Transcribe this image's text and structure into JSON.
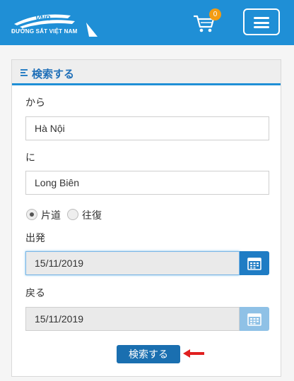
{
  "header": {
    "logo_text": "ĐƯỜNG SẮT VIỆT NAM",
    "cart_count": "0"
  },
  "form": {
    "title": "検索する",
    "from_label": "から",
    "from_value": "Hà Nội",
    "to_label": "に",
    "to_value": "Long Biên",
    "trip_options": [
      "片道",
      "往復"
    ],
    "selected_trip": "片道",
    "depart_label": "出発",
    "depart_value": "15/11/2019",
    "return_label": "戻る",
    "return_value": "15/11/2019",
    "search_button": "検索する"
  },
  "colors": {
    "brand": "#1f8fd6",
    "badge": "#f39c12",
    "arrow": "#e02020"
  }
}
